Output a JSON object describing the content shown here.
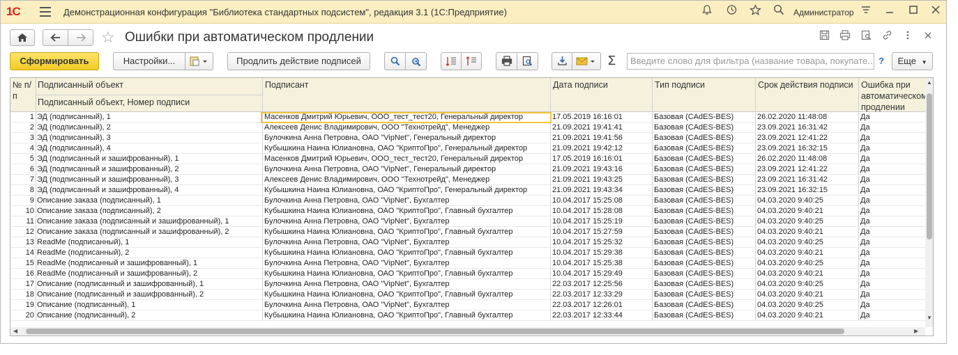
{
  "app": {
    "logo": "1С",
    "title": "Демонстрационная конфигурация \"Библиотека стандартных подсистем\", редакция 3.1  (1С:Предприятие)",
    "user": "Администратор"
  },
  "form": {
    "title": "Ошибки при автоматическом продлении"
  },
  "toolbar": {
    "generate": "Сформировать",
    "settings": "Настройки...",
    "extend": "Продлить действие подписей",
    "filter_placeholder": "Введите слово для фильтра (название товара, покупате...",
    "help": "?",
    "more": "Еще",
    "sigma": "Σ"
  },
  "table": {
    "headers": {
      "num": "№ п/п",
      "object": "Подписанный объект",
      "object_sub": "Подписанный объект, Номер подписи",
      "signer": "Подписант",
      "date": "Дата подписи",
      "type": "Тип подписи",
      "expiry": "Срок действия подписи",
      "error": "Ошибка при автоматическом продлении"
    },
    "rows": [
      {
        "num": "1",
        "object": "ЭД (подписанный), 1",
        "signer": "Масенков Дмитрий Юрьевич, ООО_тест_тест20, Генеральный директор",
        "date": "17.05.2019 16:16:01",
        "type": "Базовая (CAdES-BES)",
        "expiry": "26.02.2020 11:48:08",
        "error": "Да"
      },
      {
        "num": "2",
        "object": "ЭД (подписанный), 2",
        "signer": "Алексеев Денис Владимирович, ООО \"Технотрейд\", Менеджер",
        "date": "21.09.2021 19:41:41",
        "type": "Базовая (CAdES-BES)",
        "expiry": "23.09.2021 16:31:42",
        "error": "Да"
      },
      {
        "num": "3",
        "object": "ЭД (подписанный), 3",
        "signer": "Булочкина Анна Петровна, ОАО \"VipNet\", Генеральный директор",
        "date": "21.09.2021 19:41:56",
        "type": "Базовая (CAdES-BES)",
        "expiry": "23.09.2021 12:41:22",
        "error": "Да"
      },
      {
        "num": "4",
        "object": "ЭД (подписанный), 4",
        "signer": "Кубышкина Наина Юлиановна, ОАО \"КриптоПро\", Генеральный директор",
        "date": "21.09.2021 19:42:12",
        "type": "Базовая (CAdES-BES)",
        "expiry": "23.09.2021 16:32:15",
        "error": "Да"
      },
      {
        "num": "5",
        "object": "ЭД (подписанный и зашифрованный), 1",
        "signer": "Масенков Дмитрий Юрьевич, ООО_тест_тест20, Генеральный директор",
        "date": "17.05.2019 16:16:01",
        "type": "Базовая (CAdES-BES)",
        "expiry": "26.02.2020 11:48:08",
        "error": "Да"
      },
      {
        "num": "6",
        "object": "ЭД (подписанный и зашифрованный), 2",
        "signer": "Булочкина Анна Петровна, ОАО \"VipNet\", Генеральный директор",
        "date": "21.09.2021 19:43:16",
        "type": "Базовая (CAdES-BES)",
        "expiry": "23.09.2021 12:41:22",
        "error": "Да"
      },
      {
        "num": "7",
        "object": "ЭД (подписанный и зашифрованный), 3",
        "signer": "Алексеев Денис Владимирович, ООО \"Технотрейд\", Менеджер",
        "date": "21.09.2021 19:43:25",
        "type": "Базовая (CAdES-BES)",
        "expiry": "23.09.2021 16:31:42",
        "error": "Да"
      },
      {
        "num": "8",
        "object": "ЭД (подписанный и зашифрованный), 4",
        "signer": "Кубышкина Наина Юлиановна, ОАО \"КриптоПро\", Генеральный директор",
        "date": "21.09.2021 19:43:34",
        "type": "Базовая (CAdES-BES)",
        "expiry": "23.09.2021 16:32:15",
        "error": "Да"
      },
      {
        "num": "9",
        "object": "Описание заказа (подписанный), 1",
        "signer": "Булочкина Анна Петровна, ОАО \"VipNet\", Бухгалтер",
        "date": "10.04.2017 15:25:08",
        "type": "Базовая (CAdES-BES)",
        "expiry": "04.03.2020 9:40:25",
        "error": "Да"
      },
      {
        "num": "10",
        "object": "Описание заказа (подписанный), 2",
        "signer": "Кубышкина Наина Юлиановна, ОАО \"КриптоПро\", Главный бухгалтер",
        "date": "10.04.2017 15:28:08",
        "type": "Базовая (CAdES-BES)",
        "expiry": "04.03.2020 9:40:21",
        "error": "Да"
      },
      {
        "num": "11",
        "object": "Описание заказа (подписанный и зашифрованный), 1",
        "signer": "Булочкина Анна Петровна, ОАО \"VipNet\", Бухгалтер",
        "date": "10.04.2017 15:25:19",
        "type": "Базовая (CAdES-BES)",
        "expiry": "04.03.2020 9:40:25",
        "error": "Да"
      },
      {
        "num": "12",
        "object": "Описание заказа (подписанный и зашифрованный), 2",
        "signer": "Кубышкина Наина Юлиановна, ОАО \"КриптоПро\", Главный бухгалтер",
        "date": "10.04.2017 15:27:59",
        "type": "Базовая (CAdES-BES)",
        "expiry": "04.03.2020 9:40:21",
        "error": "Да"
      },
      {
        "num": "13",
        "object": "ReadMe (подписанный), 1",
        "signer": "Булочкина Анна Петровна, ОАО \"VipNet\", Бухгалтер",
        "date": "10.04.2017 15:25:32",
        "type": "Базовая (CAdES-BES)",
        "expiry": "04.03.2020 9:40:25",
        "error": "Да"
      },
      {
        "num": "14",
        "object": "ReadMe (подписанный), 2",
        "signer": "Кубышкина Наина Юлиановна, ОАО \"КриптоПро\", Главный бухгалтер",
        "date": "10.04.2017 15:29:38",
        "type": "Базовая (CAdES-BES)",
        "expiry": "04.03.2020 9:40:21",
        "error": "Да"
      },
      {
        "num": "15",
        "object": "ReadMe (подписанный и зашифрованный), 1",
        "signer": "Булочкина Анна Петровна, ОАО \"VipNet\", Бухгалтер",
        "date": "10.04.2017 15:25:38",
        "type": "Базовая (CAdES-BES)",
        "expiry": "04.03.2020 9:40:25",
        "error": "Да"
      },
      {
        "num": "16",
        "object": "ReadMe (подписанный и зашифрованный), 2",
        "signer": "Кубышкина Наина Юлиановна, ОАО \"КриптоПро\", Главный бухгалтер",
        "date": "10.04.2017 15:29:49",
        "type": "Базовая (CAdES-BES)",
        "expiry": "04.03.2020 9:40:21",
        "error": "Да"
      },
      {
        "num": "17",
        "object": "Описание (подписанный и зашифрованный), 1",
        "signer": "Булочкина Анна Петровна, ОАО \"VipNet\", Бухгалтер",
        "date": "22.03.2017 12:25:56",
        "type": "Базовая (CAdES-BES)",
        "expiry": "04.03.2020 9:40:25",
        "error": "Да"
      },
      {
        "num": "18",
        "object": "Описание (подписанный и зашифрованный), 2",
        "signer": "Кубышкина Наина Юлиановна, ОАО \"КриптоПро\", Главный бухгалтер",
        "date": "22.03.2017 12:33:29",
        "type": "Базовая (CAdES-BES)",
        "expiry": "04.03.2020 9:40:21",
        "error": "Да"
      },
      {
        "num": "19",
        "object": "Описание (подписанный), 1",
        "signer": "Булочкина Анна Петровна, ОАО \"VipNet\", Бухгалтер",
        "date": "22.03.2017 12:26:01",
        "type": "Базовая (CAdES-BES)",
        "expiry": "04.03.2020 9:40:25",
        "error": "Да"
      },
      {
        "num": "20",
        "object": "Описание (подписанный), 2",
        "signer": "Кубышкина Наина Юлиановна, ОАО \"КриптоПро\", Главный бухгалтер",
        "date": "22.03.2017 12:33:44",
        "type": "Базовая (CAdES-BES)",
        "expiry": "04.03.2020 9:40:21",
        "error": "Да"
      }
    ]
  },
  "icons": {
    "bell": "bell-icon",
    "history": "history-icon",
    "favorites": "star-icon",
    "search": "search-icon"
  },
  "colors": {
    "titlebar": "#fbeec1",
    "primary_button": "#f1cc25",
    "header_bg": "#f5f1dc",
    "selection": "#f2c53d"
  }
}
